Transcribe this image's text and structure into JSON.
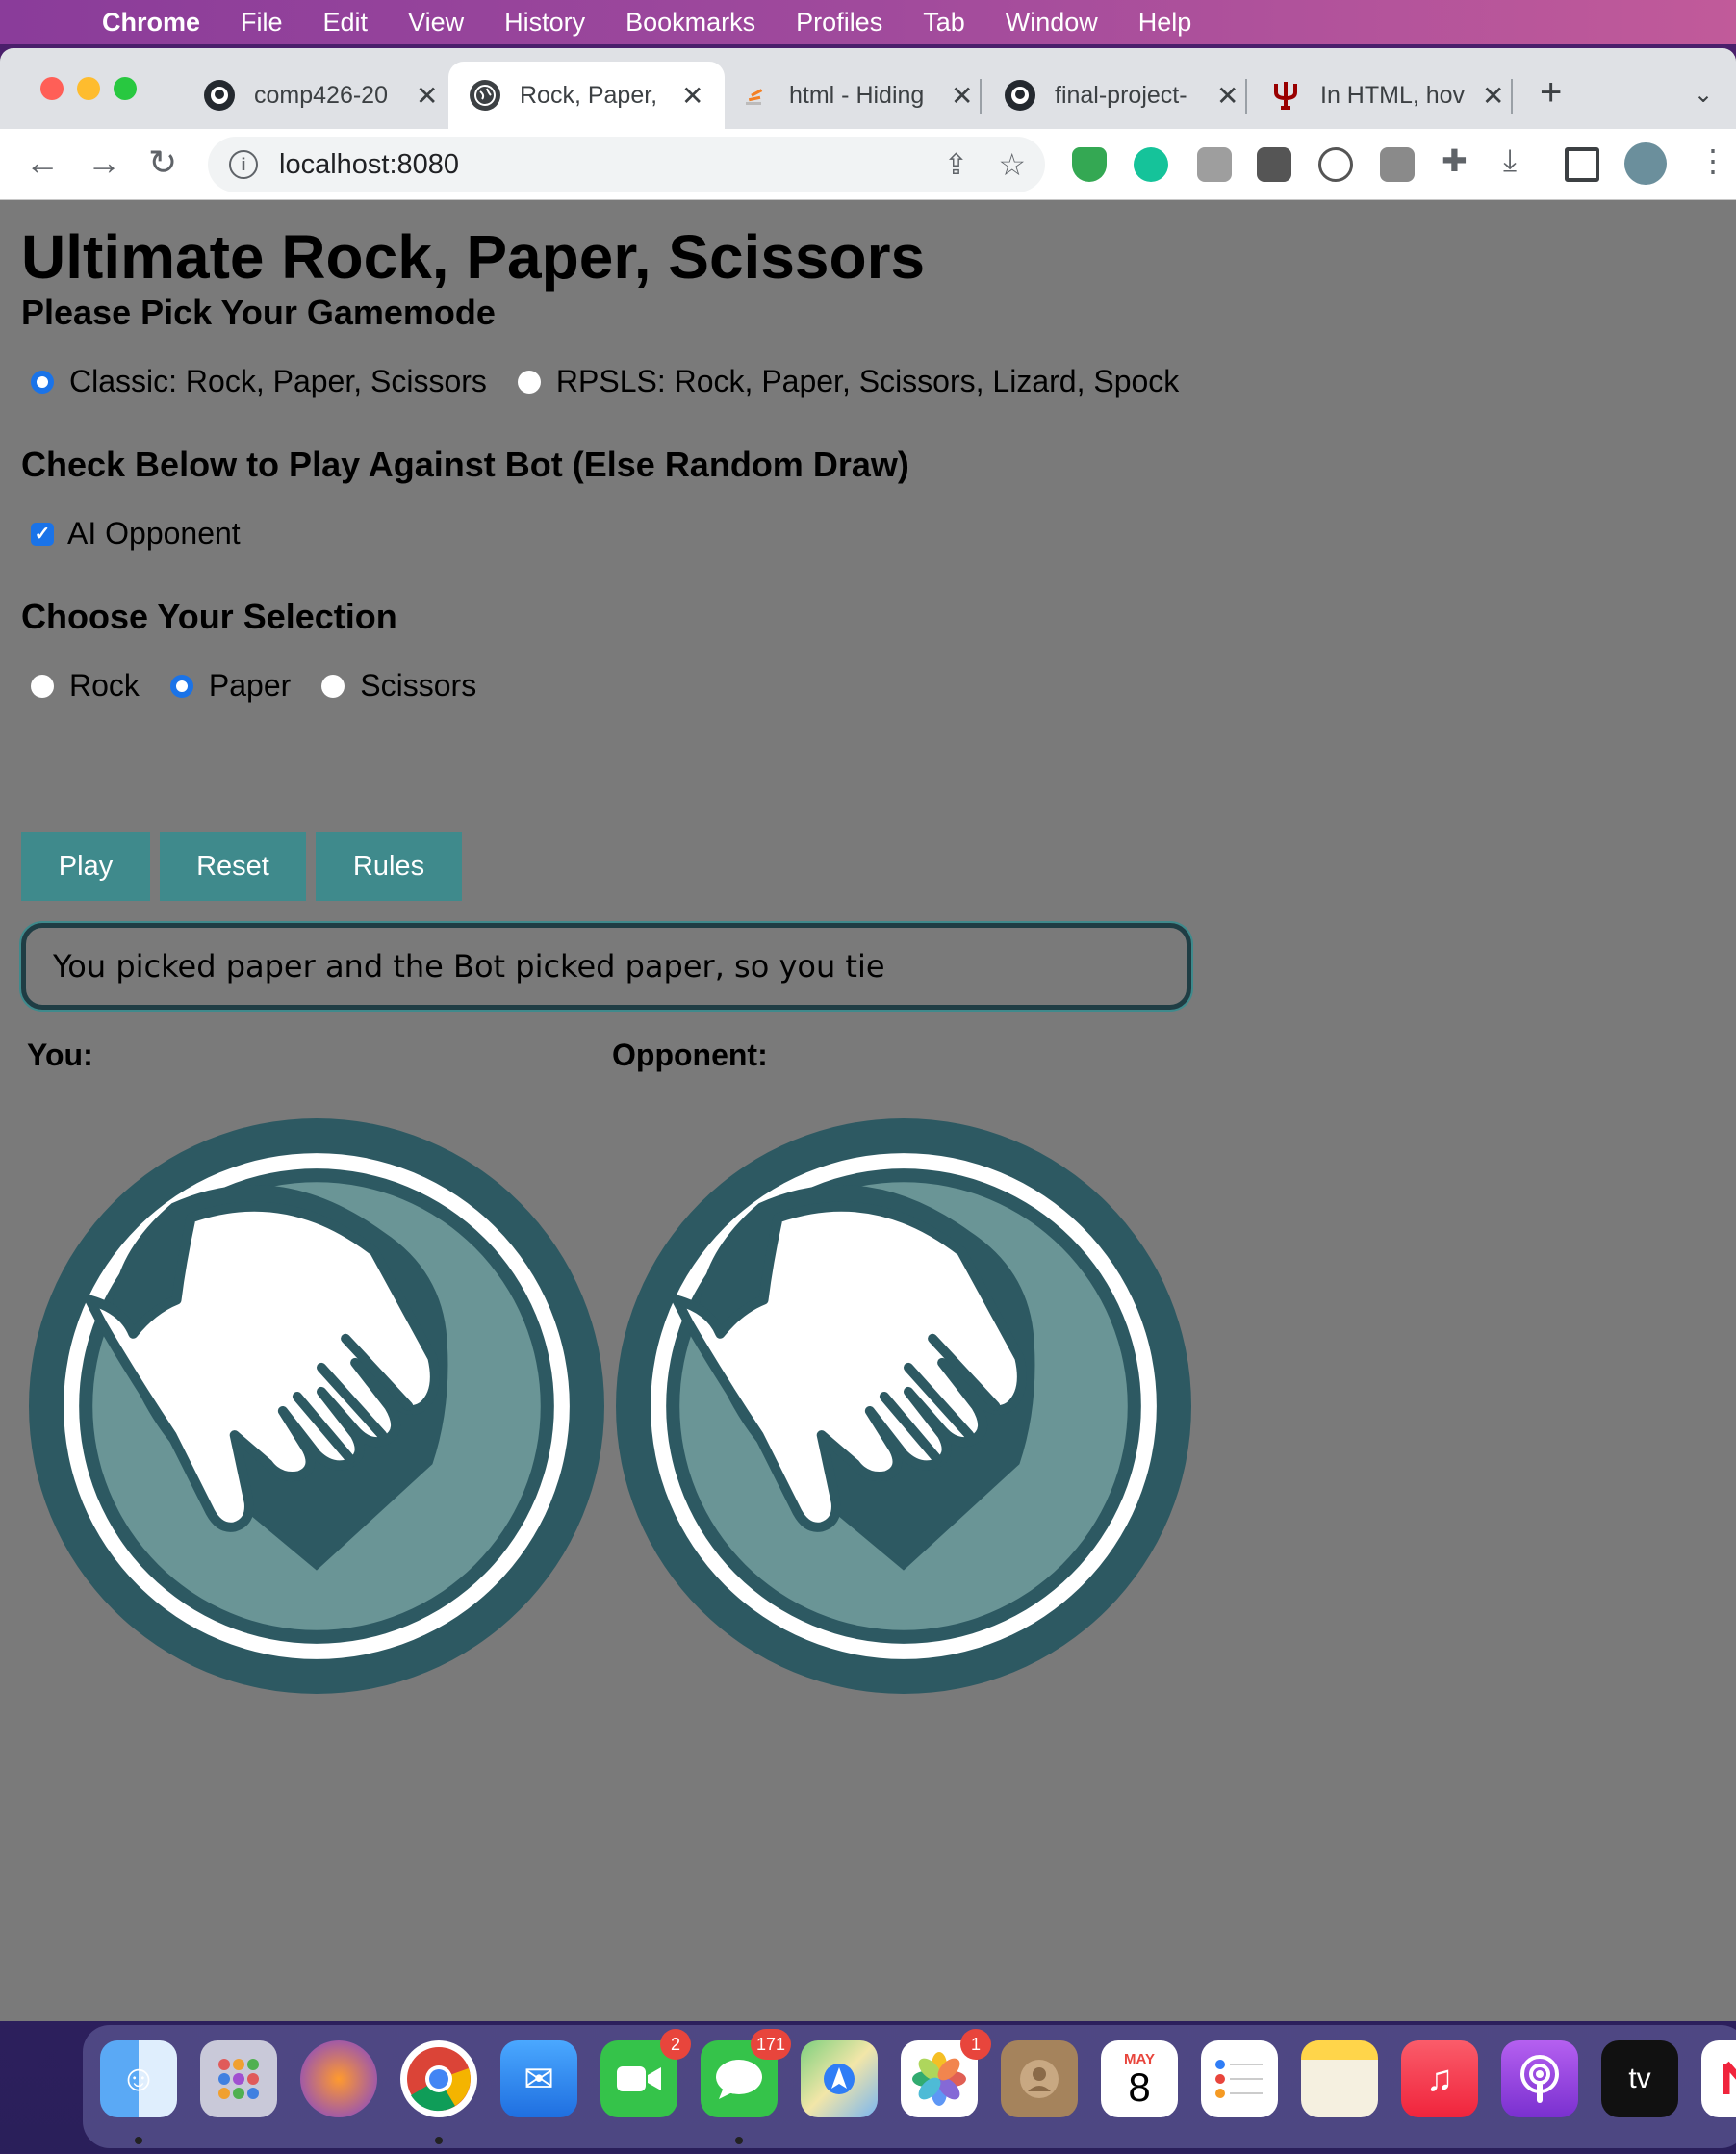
{
  "menubar": {
    "app": "Chrome",
    "items": [
      "File",
      "Edit",
      "View",
      "History",
      "Bookmarks",
      "Profiles",
      "Tab",
      "Window",
      "Help"
    ]
  },
  "browser": {
    "tabs": [
      {
        "title": "comp426-20",
        "icon": "github-icon",
        "active": false
      },
      {
        "title": "Rock, Paper,",
        "icon": "globe-icon",
        "active": true
      },
      {
        "title": "html - Hiding",
        "icon": "stackoverflow-icon",
        "active": false
      },
      {
        "title": "final-project-",
        "icon": "github-icon",
        "active": false
      },
      {
        "title": "In HTML, hov",
        "icon": "trident-icon",
        "active": false
      }
    ],
    "url": "localhost:8080"
  },
  "page": {
    "title": "Ultimate Rock, Paper, Scissors",
    "gamemode_heading": "Please Pick Your Gamemode",
    "gamemodes": [
      {
        "label": "Classic: Rock, Paper, Scissors",
        "checked": true
      },
      {
        "label": "RPSLS: Rock, Paper, Scissors, Lizard, Spock",
        "checked": false
      }
    ],
    "bot_heading": "Check Below to Play Against Bot (Else Random Draw)",
    "ai_opponent_label": "AI Opponent",
    "ai_opponent_checked": true,
    "selection_heading": "Choose Your Selection",
    "selections": [
      {
        "label": "Rock",
        "checked": false
      },
      {
        "label": "Paper",
        "checked": true
      },
      {
        "label": "Scissors",
        "checked": false
      }
    ],
    "buttons": {
      "play": "Play",
      "reset": "Reset",
      "rules": "Rules"
    },
    "result": "You picked paper and the Bot picked paper, so you tie",
    "you_label": "You:",
    "opponent_label": "Opponent:",
    "you_choice": "paper",
    "opponent_choice": "paper"
  },
  "dock": {
    "badges": {
      "facetime": "2",
      "messages": "171",
      "photos": "1"
    },
    "calendar": {
      "month": "MAY",
      "day": "8"
    }
  },
  "colors": {
    "page_bg": "#7a7a7a",
    "button_bg": "#3f8a8c",
    "hand_ring": "#2d5962",
    "hand_fill": "#6a9596",
    "radio_checked": "#1a73e8"
  }
}
